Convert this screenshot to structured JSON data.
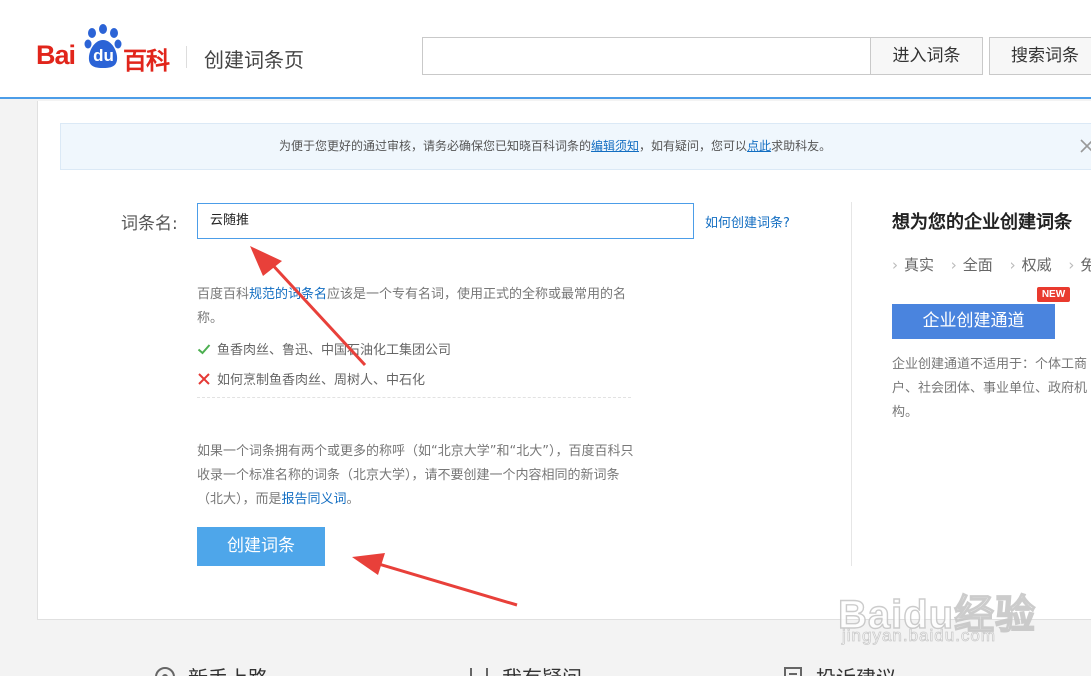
{
  "header": {
    "logo_bai": "Bai",
    "logo_du": "du",
    "logo_baike": "百科",
    "page_title": "创建词条页",
    "search_value": "",
    "enter_button": "进入词条",
    "search_button": "搜索词条"
  },
  "notice": {
    "text_before": "为便于您更好的通过审核，请务必确保您已知晓百科词条的",
    "link1": "编辑须知",
    "text_middle": "，如有疑问，您可以",
    "link2": "点此",
    "text_after": "求助科友。"
  },
  "form": {
    "name_label": "词条名:",
    "name_value": "云随推",
    "how_link": "如何创建词条?",
    "tip1_before": "百度百科",
    "tip1_link": "规范的词条名",
    "tip1_after": "应该是一个专有名词，使用正式的全称或最常用的名称。",
    "good_example": "鱼香肉丝、鲁迅、中国石油化工集团公司",
    "bad_example": "如何烹制鱼香肉丝、周树人、中石化",
    "tip2_before": "如果一个词条拥有两个或更多的称呼（如“北京大学”和“北大”），百度百科只收录一个标准名称的词条（北京大学），请不要创建一个内容相同的新词条（北大），而是",
    "tip2_link": "报告同义词",
    "tip2_after": "。",
    "create_button": "创建词条"
  },
  "enterprise": {
    "title": "想为您的企业创建词条",
    "features": [
      "真实",
      "全面",
      "权威",
      "免费"
    ],
    "button": "企业创建通道",
    "badge": "NEW",
    "note": "企业创建通道不适用于：个体工商户、社会团体、事业单位、政府机构。"
  },
  "footer": {
    "items": [
      "新手上路",
      "我有疑问",
      "投诉建议"
    ]
  },
  "watermark": {
    "logo": "Baidu经验",
    "url": "jingyan.baidu.com"
  },
  "colors": {
    "brand_red": "#e1251b",
    "brand_blue": "#2b63d6",
    "accent_blue": "#4c9de8",
    "link_blue": "#136ec2",
    "arrow_red": "#e8403a"
  }
}
